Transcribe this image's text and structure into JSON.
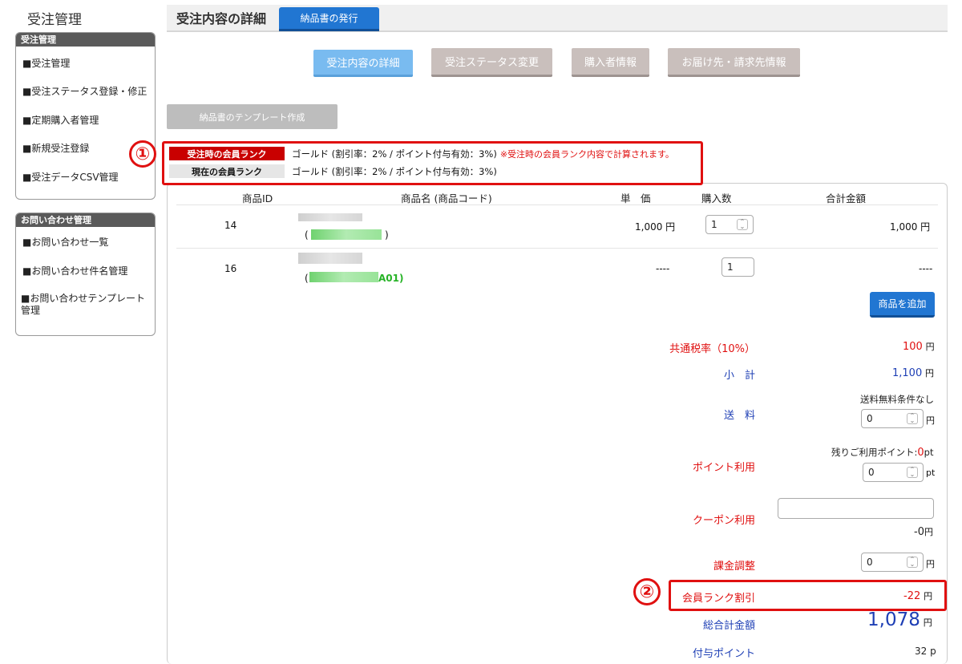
{
  "sidebar": {
    "app_title": "受注管理",
    "section1": {
      "header": "受注管理",
      "items": [
        "■受注管理",
        "■受注ステータス登録・修正",
        "■定期購入者管理",
        "■新規受注登録",
        "■受注データCSV管理"
      ]
    },
    "section2": {
      "header": "お問い合わせ管理",
      "items": [
        "■お問い合わせ一覧",
        "■お問い合わせ件名管理",
        "■お問い合わせテンプレート管理"
      ]
    }
  },
  "header": {
    "title": "受注内容の詳細",
    "button": "納品書の発行"
  },
  "tabs": [
    "受注内容の詳細",
    "受注ステータス変更",
    "購入者情報",
    "お届け先・請求先情報"
  ],
  "template_button": "納品書のテンプレート作成",
  "rank": {
    "label_order": "受注時の会員ランク",
    "value_order": "ゴールド (割引率：2% / ポイント付与有効：3%)",
    "note": "※受注時の会員ランク内容で計算されます。",
    "label_current": "現在の会員ランク",
    "value_current": "ゴールド (割引率：2% / ポイント付与有効：3%)"
  },
  "annotations": {
    "one": "①",
    "two": "②"
  },
  "table": {
    "headers": [
      "商品ID",
      "商品名 (商品コード)",
      "単　価",
      "購入数",
      "合計金額"
    ],
    "rows": [
      {
        "id": "14",
        "code_prefix": "(",
        "code_suffix": ")",
        "price": "1,000 円",
        "qty": "1",
        "total": "1,000 円"
      },
      {
        "id": "16",
        "code_prefix": "(",
        "code_suffix": "A01)",
        "price": "----",
        "qty": "1",
        "total": "----"
      }
    ]
  },
  "add_button": "商品を追加",
  "summary": {
    "tax_label": "共通税率（10%）",
    "tax_value": "100",
    "subtotal_label": "小　計",
    "subtotal_value": "1,100",
    "shipping_label": "送　料",
    "shipping_note": "送料無料条件なし",
    "shipping_value": "0",
    "points_label": "ポイント利用",
    "points_remaining_label": "残りご利用ポイント:",
    "points_remaining_value": "0",
    "points_unit": "pt",
    "points_value": "0",
    "coupon_label": "クーポン利用",
    "coupon_value": "",
    "coupon_amount": "-0",
    "adjust_label": "課金調整",
    "adjust_value": "0",
    "rank_discount_label": "会員ランク割引",
    "rank_discount_value": "-22",
    "total_label": "総合計金額",
    "total_value": "1,078",
    "grant_points_label": "付与ポイント",
    "grant_points_value": "32 p",
    "yen": "円"
  }
}
